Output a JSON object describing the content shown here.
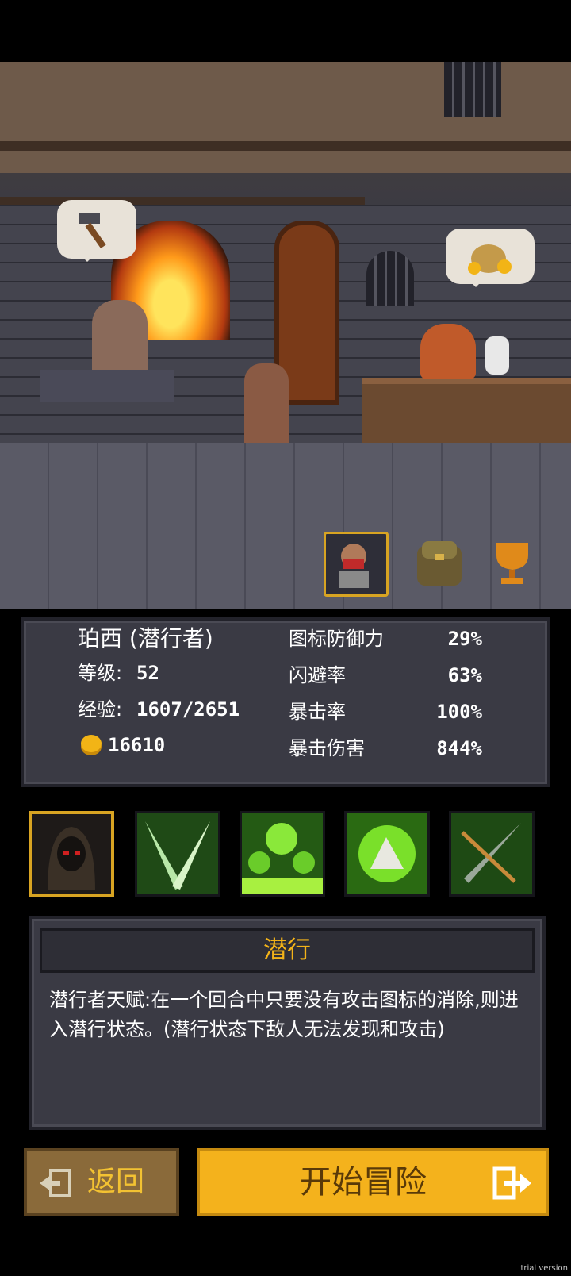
{
  "hero": {
    "name": "珀西 (潜行者)",
    "level_label": "等级:",
    "level": "52",
    "exp_label": "经验:",
    "exp": "1607/2651",
    "gold": "16610"
  },
  "stats": [
    {
      "label": "图标防御力",
      "value": "29%"
    },
    {
      "label": "闪避率",
      "value": "63%"
    },
    {
      "label": "暴击率",
      "value": "100%"
    },
    {
      "label": "暴击伤害",
      "value": "844%"
    }
  ],
  "top_icons": [
    "hero-portrait-icon",
    "backpack-icon",
    "trophy-icon"
  ],
  "skills": [
    {
      "icon": "hooded-rogue-icon",
      "selected": true
    },
    {
      "icon": "crossed-blades-icon",
      "selected": false
    },
    {
      "icon": "poison-trees-icon",
      "selected": false
    },
    {
      "icon": "glowing-rock-icon",
      "selected": false
    },
    {
      "icon": "sword-arrows-icon",
      "selected": false
    }
  ],
  "skill_detail": {
    "title": "潜行",
    "description": "潜行者天赋:在一个回合中只要没有攻击图标的消除,则进入潜行状态。(潜行状态下敌人无法发现和攻击)"
  },
  "buttons": {
    "back": "返回",
    "start": "开始冒险"
  },
  "watermark": "trial version",
  "colors": {
    "accent": "#f3b319",
    "panel": "#3a3a44",
    "border": "#22222a"
  }
}
